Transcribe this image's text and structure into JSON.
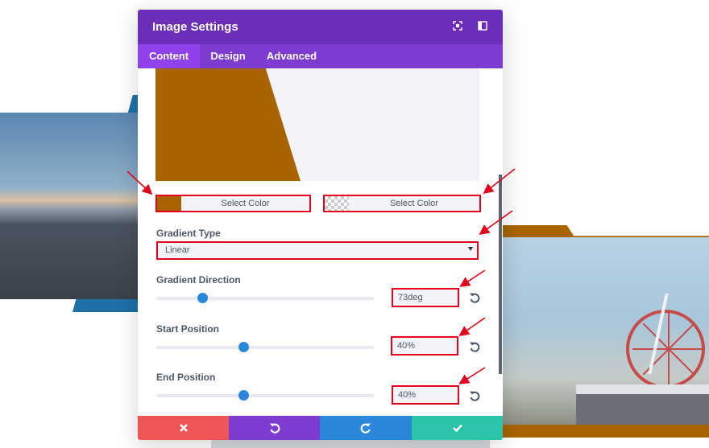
{
  "modal": {
    "title": "Image Settings",
    "header_icons": [
      "fullscreen-icon",
      "sidebar-icon"
    ],
    "tabs": [
      {
        "label": "Content",
        "active": true
      },
      {
        "label": "Design",
        "active": false
      },
      {
        "label": "Advanced",
        "active": false
      }
    ]
  },
  "gradient": {
    "preview_color": "#a86400",
    "start_color_label": "Select Color",
    "end_color_label": "Select Color",
    "start_color": "#a86400",
    "end_color": "transparent",
    "type_label": "Gradient Type",
    "type_value": "Linear",
    "direction_label": "Gradient Direction",
    "direction_value": "73deg",
    "direction_level": 0.21,
    "start_position_label": "Start Position",
    "start_position_value": "40%",
    "start_position_level": 0.4,
    "end_position_label": "End Position",
    "end_position_value": "40%",
    "end_position_level": 0.4
  },
  "footer": {
    "buttons": [
      {
        "icon": "close-icon",
        "color": "#ef5555"
      },
      {
        "icon": "undo-icon",
        "color": "#7e3bd0"
      },
      {
        "icon": "redo-icon",
        "color": "#2b87da"
      },
      {
        "icon": "checkmark-icon",
        "color": "#29c4a9"
      }
    ]
  },
  "colors": {
    "header": "#6c2eb9",
    "tabs": "#7e3bd0",
    "active_tab": "#8f42ec",
    "highlight": "#e2001a",
    "slider": "#2b87da"
  }
}
